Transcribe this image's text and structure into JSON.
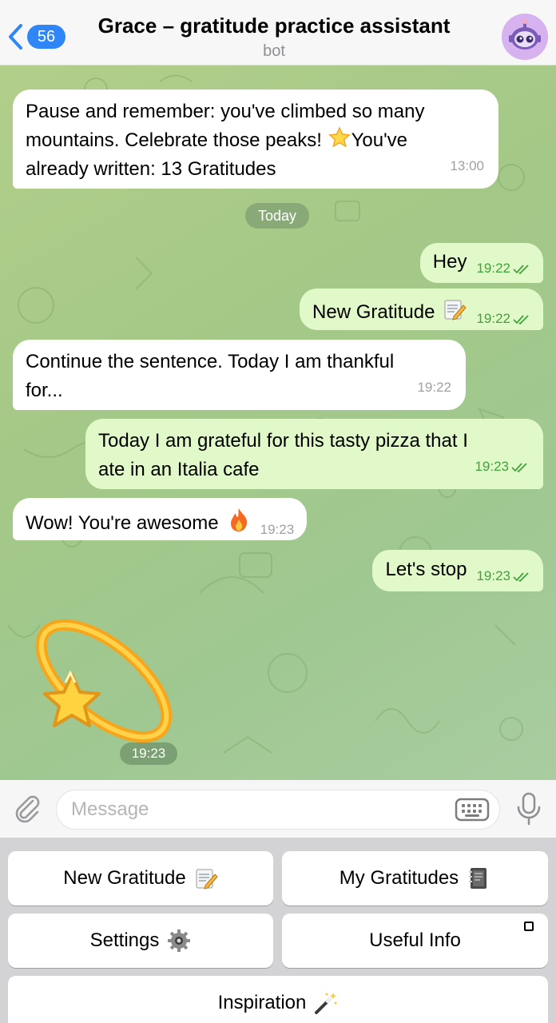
{
  "header": {
    "back_count": "56",
    "title": "Grace – gratitude practice assistant",
    "subtitle": "bot"
  },
  "chat": {
    "messages": [
      {
        "side": "in",
        "text_line1": "Pause and remember: you've climbed so many",
        "text_line2": "mountains. Celebrate those peaks!",
        "text_line2b": "You've",
        "text_line3": "already written: 13 Gratitudes",
        "time": "13:00"
      },
      {
        "side": "date",
        "text": "Today"
      },
      {
        "side": "out",
        "text": "Hey",
        "time": "19:22"
      },
      {
        "side": "out",
        "text": "New Gratitude",
        "time": "19:22"
      },
      {
        "side": "in",
        "text_line1": "Continue the sentence. Today I am thankful",
        "text_line2": "for...",
        "time": "19:22"
      },
      {
        "side": "out",
        "text_line1": "Today I am grateful for this tasty pizza that I",
        "text_line2": "ate in an Italia cafe",
        "time": "19:23"
      },
      {
        "side": "in",
        "text": "Wow! You're awesome",
        "time": "19:23"
      },
      {
        "side": "out",
        "text": "Let's stop",
        "time": "19:23"
      },
      {
        "side": "sticker",
        "time": "19:23"
      }
    ]
  },
  "input": {
    "placeholder": "Message"
  },
  "keyboard": {
    "new_gratitude": "New Gratitude",
    "my_gratitudes": "My Gratitudes",
    "settings": "Settings",
    "useful_info": "Useful Info",
    "inspiration": "Inspiration"
  },
  "icons": {
    "back": "chevron-left-icon",
    "attach": "paperclip-icon",
    "keyboard": "keyboard-icon",
    "mic": "microphone-icon",
    "sent": "double-check-icon"
  },
  "colors": {
    "accent": "#2f86f6",
    "outgoing_bubble": "#e1f9c9",
    "sent_time": "#41a33b"
  }
}
